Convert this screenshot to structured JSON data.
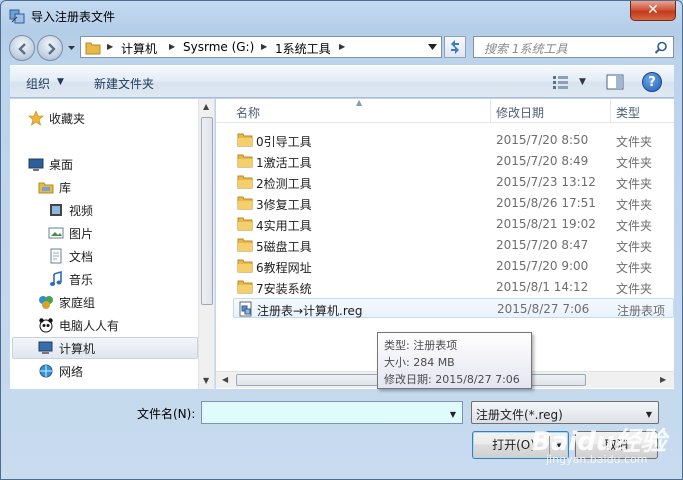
{
  "window": {
    "title": "导入注册表文件",
    "close_label": "✕"
  },
  "address": {
    "parts": [
      "计算机",
      "Sysrme (G:)",
      "1系统工具"
    ]
  },
  "search": {
    "placeholder": "搜索 1系统工具"
  },
  "toolbar": {
    "organize": "组织",
    "new_folder": "新建文件夹"
  },
  "nav": {
    "items": [
      {
        "label": "收藏夹",
        "icon": "star-icon"
      },
      {
        "label": "桌面",
        "icon": "desktop-icon"
      },
      {
        "label": "库",
        "icon": "library-icon"
      },
      {
        "label": "视频",
        "icon": "video-icon"
      },
      {
        "label": "图片",
        "icon": "picture-icon"
      },
      {
        "label": "文档",
        "icon": "document-icon"
      },
      {
        "label": "音乐",
        "icon": "music-icon"
      },
      {
        "label": "家庭组",
        "icon": "homegroup-icon"
      },
      {
        "label": "电脑人人有",
        "icon": "panda-icon"
      },
      {
        "label": "计算机",
        "icon": "computer-icon"
      },
      {
        "label": "网络",
        "icon": "network-icon"
      }
    ],
    "selected": "计算机"
  },
  "columns": {
    "name": "名称",
    "date": "修改日期",
    "type": "类型"
  },
  "files": [
    {
      "name": "0引导工具",
      "date": "2015/7/20 8:50",
      "type": "文件夹",
      "kind": "folder"
    },
    {
      "name": "1激活工具",
      "date": "2015/7/20 8:49",
      "type": "文件夹",
      "kind": "folder"
    },
    {
      "name": "2检测工具",
      "date": "2015/7/23 13:12",
      "type": "文件夹",
      "kind": "folder"
    },
    {
      "name": "3修复工具",
      "date": "2015/8/26 17:51",
      "type": "文件夹",
      "kind": "folder"
    },
    {
      "name": "4实用工具",
      "date": "2015/8/21 19:02",
      "type": "文件夹",
      "kind": "folder"
    },
    {
      "name": "5磁盘工具",
      "date": "2015/7/20 8:47",
      "type": "文件夹",
      "kind": "folder"
    },
    {
      "name": "6教程网址",
      "date": "2015/7/20 9:00",
      "type": "文件夹",
      "kind": "folder"
    },
    {
      "name": "7安装系统",
      "date": "2015/8/1 14:12",
      "type": "文件夹",
      "kind": "folder"
    },
    {
      "name": "注册表→计算机.reg",
      "date": "2015/8/27 7:06",
      "type": "注册表项",
      "kind": "reg"
    }
  ],
  "tooltip": {
    "type_line": "类型: 注册表项",
    "size_line": "大小: 284 MB",
    "date_line": "修改日期: 2015/8/27 7:06"
  },
  "filename": {
    "label": "文件名(N):",
    "value": ""
  },
  "filter": {
    "selected": "注册文件(*.reg)"
  },
  "buttons": {
    "open": "打开(O)",
    "cancel": "取消"
  },
  "watermark": {
    "text": "Baidu经验",
    "sub": "jingyan.baidu.com"
  },
  "colors": {
    "folder": "#e8b948",
    "selection": "#dfe6ee",
    "filename_bg": "#e0fbfc"
  }
}
